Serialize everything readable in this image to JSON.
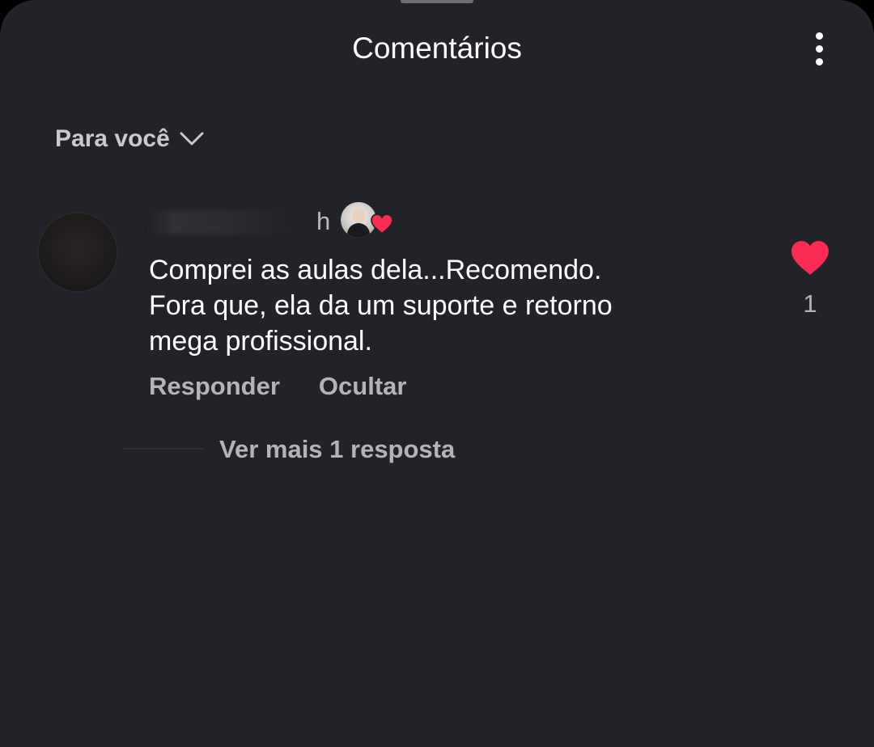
{
  "header": {
    "title": "Comentários",
    "more_icon": "more-vertical-icon"
  },
  "sort": {
    "label": "Para você",
    "icon": "chevron-down-icon"
  },
  "comment": {
    "time": "h",
    "text_lines": [
      "Comprei as aulas dela...Recomendo.",
      "Fora que, ela da um suporte e retorno",
      "mega profissional."
    ],
    "reply_label": "Responder",
    "hide_label": "Ocultar",
    "like_count": "1",
    "liked": true,
    "liked_by_creator": true,
    "view_replies_label": "Ver mais 1 resposta"
  },
  "colors": {
    "background": "#222328",
    "text_primary": "#ffffff",
    "text_secondary": "#b3b4b8",
    "heart": "#fe2c55"
  }
}
